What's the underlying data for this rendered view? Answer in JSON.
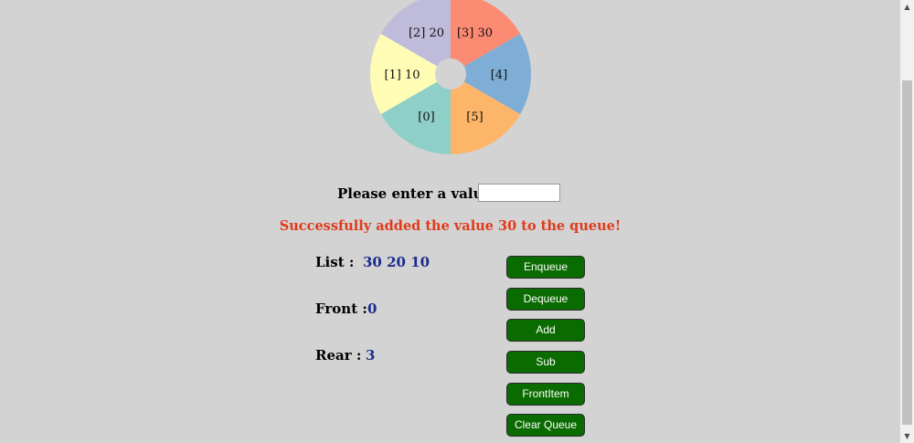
{
  "queue_slots": [
    {
      "index_label": "[0]",
      "value": "",
      "color": "#8ecfc7"
    },
    {
      "index_label": "[1]",
      "value": "10",
      "color": "#fffcb6"
    },
    {
      "index_label": "[2]",
      "value": "20",
      "color": "#bfbbdb"
    },
    {
      "index_label": "[3]",
      "value": "30",
      "color": "#fd8a72"
    },
    {
      "index_label": "[4]",
      "value": "",
      "color": "#7eaed6"
    },
    {
      "index_label": "[5]",
      "value": "",
      "color": "#fdb669"
    }
  ],
  "prompt": {
    "label": "Please enter a value :",
    "value": "",
    "placeholder": ""
  },
  "message": "Successfully added the value 30 to the queue!",
  "status": {
    "list_label": "List :",
    "list_value": "30 20 10",
    "front_label": "Front :",
    "front_value": "0",
    "rear_label": "Rear :",
    "rear_value": "3"
  },
  "buttons": {
    "enqueue": "Enqueue",
    "dequeue": "Dequeue",
    "add": "Add",
    "sub": "Sub",
    "front_item": "FrontItem",
    "clear_queue": "Clear Queue"
  },
  "scrollbar": {
    "up_icon": "triangle-up-icon",
    "down_icon": "triangle-down-icon"
  }
}
